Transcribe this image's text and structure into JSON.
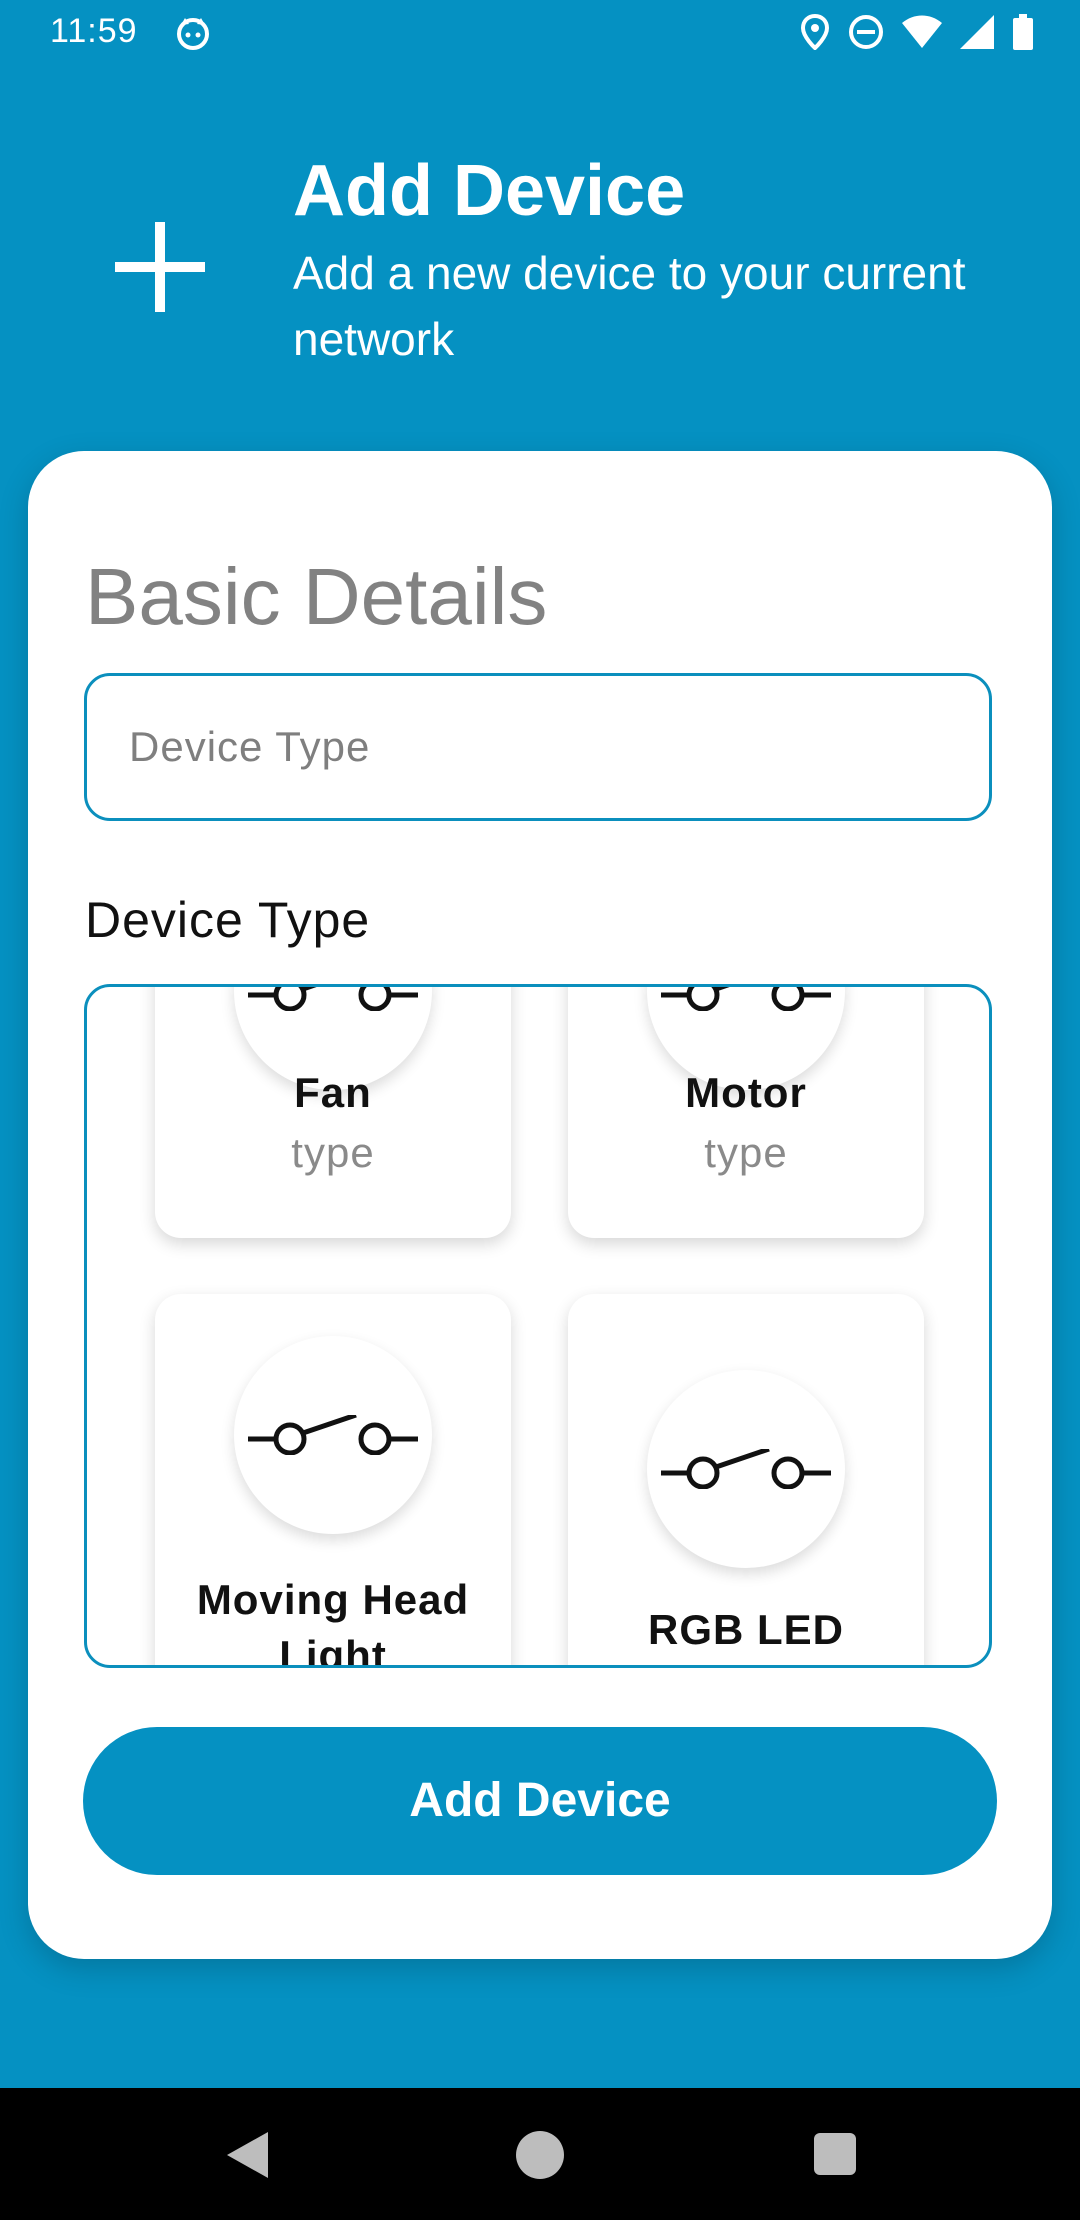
{
  "status_bar": {
    "time": "11:59",
    "icons": [
      "cat-icon",
      "location-icon",
      "do-not-disturb-icon",
      "wifi-icon",
      "signal-icon",
      "battery-icon"
    ]
  },
  "header": {
    "icon": "plus-icon",
    "title": "Add Device",
    "subtitle": "Add a new device to your current network"
  },
  "form": {
    "section_title": "Basic Details",
    "device_type_input": {
      "placeholder": "Device Type",
      "value": ""
    },
    "device_type_label": "Device Type",
    "tiles": [
      {
        "name": "Fan",
        "type": "type",
        "icon": "switch-icon"
      },
      {
        "name": "Motor",
        "type": "type",
        "icon": "switch-icon"
      },
      {
        "name": "Moving Head Light",
        "type": "",
        "icon": "switch-icon"
      },
      {
        "name": "RGB LED",
        "type": "",
        "icon": "switch-icon"
      }
    ],
    "submit_label": "Add Device"
  },
  "nav_bar": {
    "icons": [
      "back-icon",
      "home-icon",
      "recents-icon"
    ]
  },
  "colors": {
    "primary": "#0591c2",
    "border": "#0b8fbd",
    "card": "#ffffff"
  }
}
